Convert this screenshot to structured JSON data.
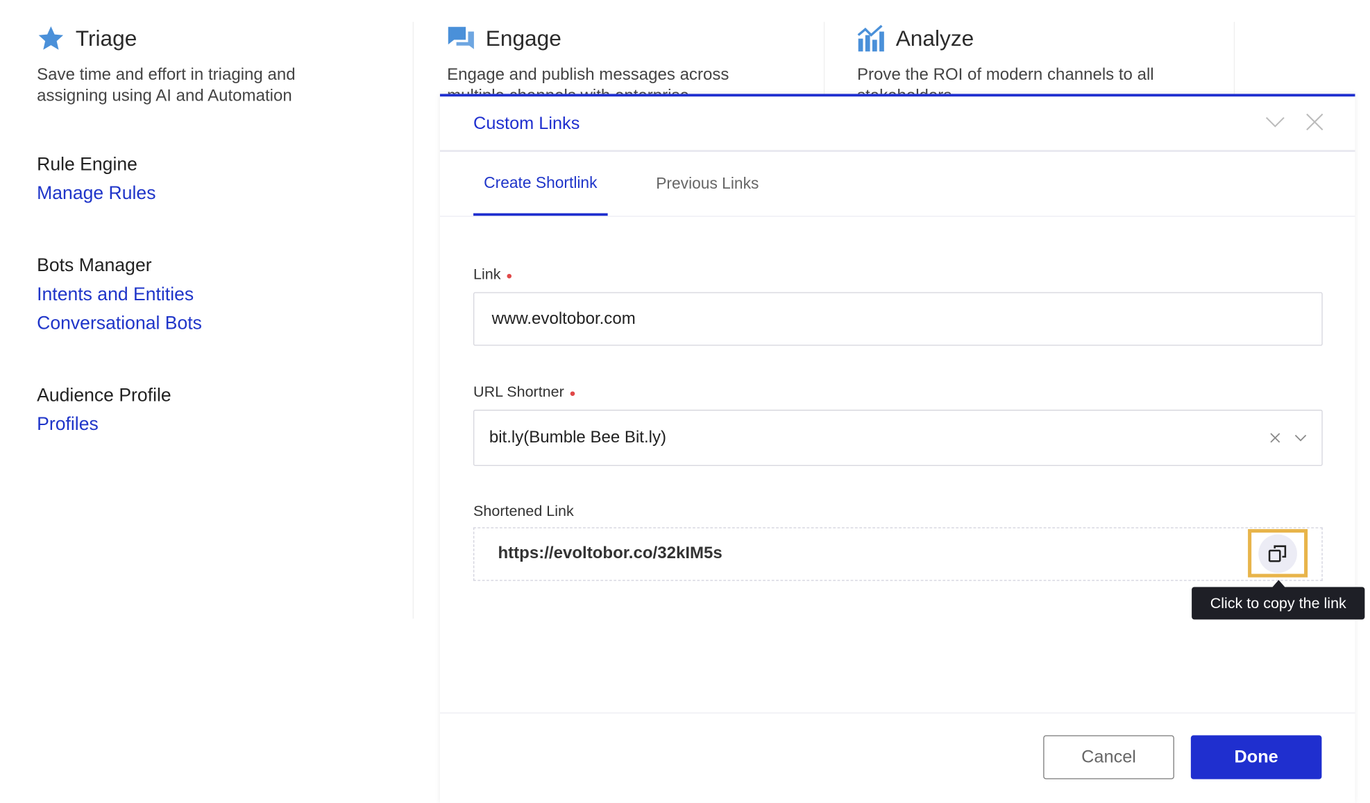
{
  "columns": [
    {
      "title": "Triage",
      "icon": "star-icon",
      "description": "Save time and effort in triaging and assigning using AI and Automation"
    },
    {
      "title": "Engage",
      "icon": "chat-bubbles-icon",
      "description": "Engage and publish messages across multiple channels with enterprise"
    },
    {
      "title": "Analyze",
      "icon": "bar-chart-icon",
      "description": "Prove the ROI of modern channels to all stakeholders"
    }
  ],
  "sections": [
    {
      "heading": "Rule Engine",
      "links": [
        "Manage Rules"
      ]
    },
    {
      "heading": "Bots Manager",
      "links": [
        "Intents and Entities",
        "Conversational Bots"
      ]
    },
    {
      "heading": "Audience Profile",
      "links": [
        "Profiles"
      ]
    }
  ],
  "modal": {
    "title": "Custom Links",
    "tabs": [
      {
        "label": "Create Shortlink",
        "active": true
      },
      {
        "label": "Previous Links",
        "active": false
      }
    ],
    "link_label": "Link",
    "link_value": "www.evoltobor.com",
    "shortener_label": "URL Shortner",
    "shortener_value": "bit.ly(Bumble Bee Bit.ly)",
    "shortened_label": "Shortened Link",
    "shortened_value": "https://evoltobor.co/32kIM5s",
    "tooltip": "Click to copy the link",
    "cancel": "Cancel",
    "done": "Done"
  },
  "colors": {
    "accent": "#1f2fcf",
    "link": "#1f35c9",
    "icon": "#4a90d9",
    "highlight": "#e8b44a",
    "tooltip_bg": "#1e1f26"
  }
}
